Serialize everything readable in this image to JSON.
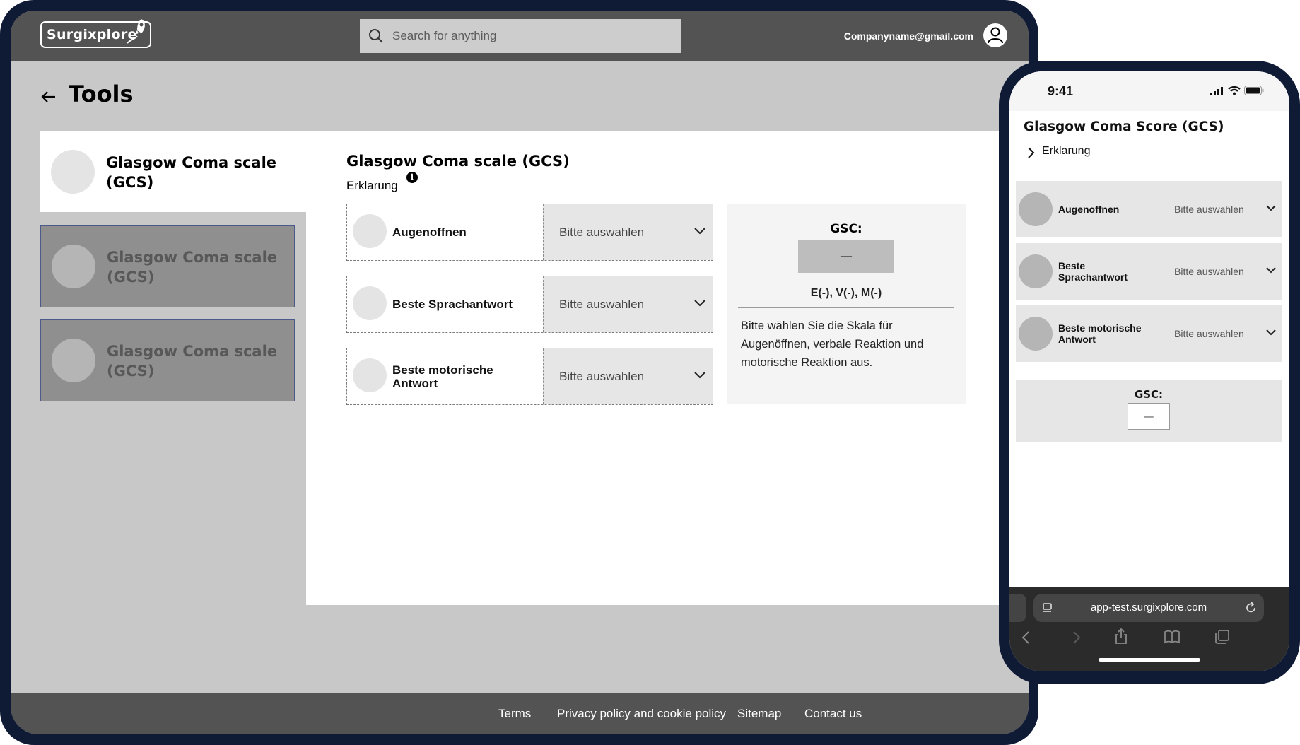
{
  "desktop": {
    "logo": "Surgixplore",
    "search_placeholder": "Search for anything",
    "user_email": "Companyname@gmail.com",
    "page_title": "Tools",
    "sidebar_items": [
      {
        "label": "Glasgow Coma scale (GCS)",
        "active": true
      },
      {
        "label": "Glasgow Coma scale (GCS)",
        "active": false
      },
      {
        "label": "Glasgow Coma scale (GCS)",
        "active": false
      }
    ],
    "main": {
      "title": "Glasgow Coma scale (GCS)",
      "explanation_label": "Erklarung",
      "info_icon": "i",
      "rows": [
        {
          "label": "Augenoffnen",
          "select": "Bitte auswahlen"
        },
        {
          "label": "Beste Sprachantwort",
          "select": "Bitte auswahlen"
        },
        {
          "label": "Beste motorische Antwort",
          "select": "Bitte auswahlen"
        }
      ],
      "result": {
        "title": "GSC:",
        "value": "—",
        "summary": "E(-), V(-), M(-)",
        "description": "Bitte wählen Sie die Skala für Augenöffnen, verbale Reaktion und motorische Reaktion aus."
      }
    },
    "footer": [
      "Terms",
      "Privacy policy and cookie policy",
      "Sitemap",
      "Contact us"
    ]
  },
  "mobile": {
    "time": "9:41",
    "title": "Glasgow Coma Score (GCS)",
    "explanation_label": "Erklarung",
    "rows": [
      {
        "label": "Augenoffnen",
        "select": "Bitte auswahlen"
      },
      {
        "label": "Beste Sprachantwort",
        "select": "Bitte auswahlen"
      },
      {
        "label": "Beste motorische Antwort",
        "select": "Bitte auswahlen"
      }
    ],
    "result": {
      "title": "GSC:",
      "value": "—"
    },
    "url": "app-test.surgixplore.com"
  },
  "colors": {
    "frame": "#0f1a35",
    "header": "#535353",
    "background": "#c8c8c8",
    "sidebar_inactive": "#8f8f8f"
  }
}
